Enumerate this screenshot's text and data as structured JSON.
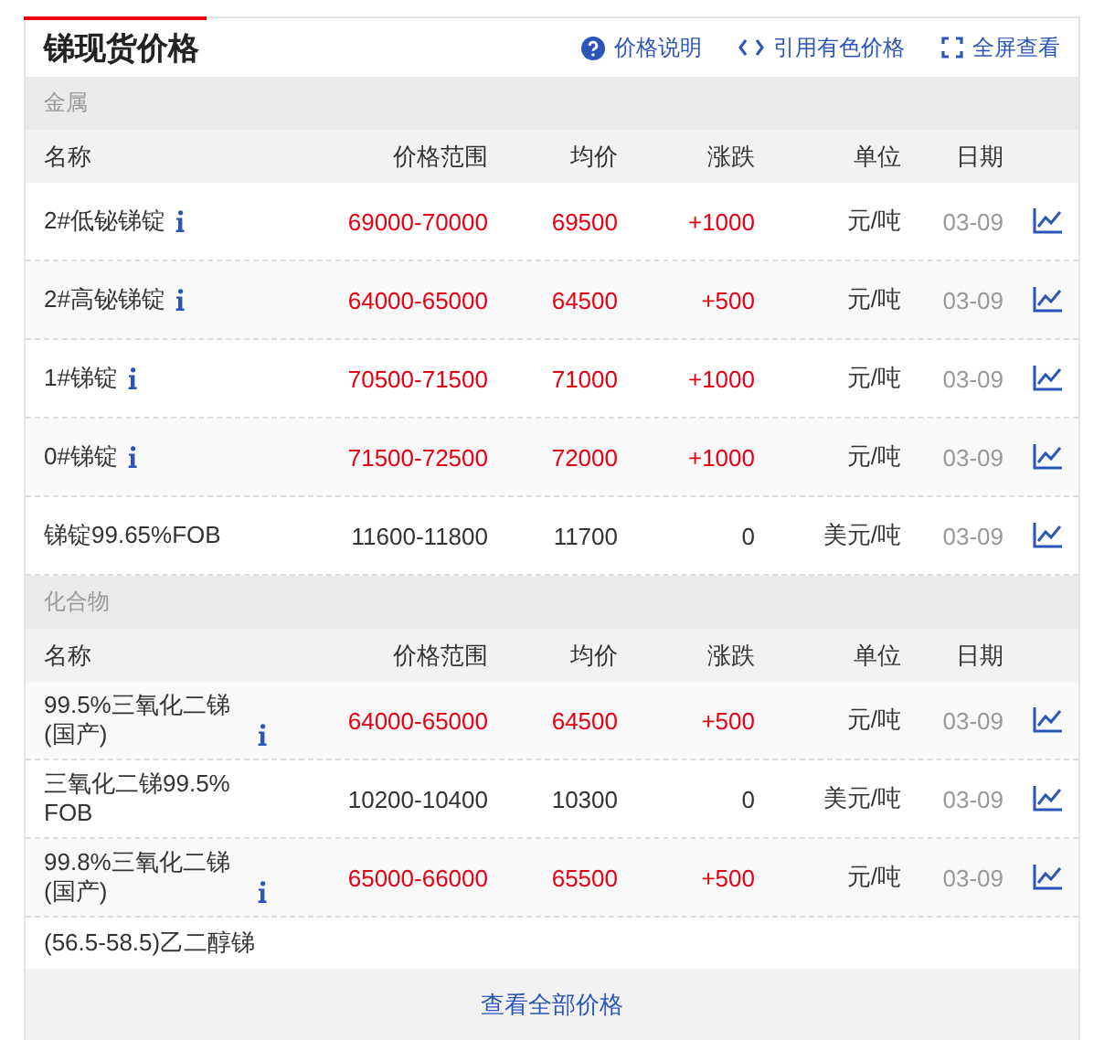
{
  "panel": {
    "title": "锑现货价格",
    "actions": [
      {
        "kind": "help",
        "label": "价格说明"
      },
      {
        "kind": "embed",
        "label": "引用有色价格"
      },
      {
        "kind": "fullscreen",
        "label": "全屏查看"
      }
    ]
  },
  "sections": [
    {
      "category": "金属",
      "columns": [
        "名称",
        "价格范围",
        "均价",
        "涨跌",
        "单位",
        "日期"
      ],
      "rows": [
        {
          "name": "2#低铋锑锭",
          "info": true,
          "range": "69000-70000",
          "average": "69500",
          "change": "+1000",
          "rising": true,
          "unit": "元/吨",
          "date": "03-09"
        },
        {
          "name": "2#高铋锑锭",
          "info": true,
          "range": "64000-65000",
          "average": "64500",
          "change": "+500",
          "rising": true,
          "unit": "元/吨",
          "date": "03-09"
        },
        {
          "name": "1#锑锭",
          "info": true,
          "range": "70500-71500",
          "average": "71000",
          "change": "+1000",
          "rising": true,
          "unit": "元/吨",
          "date": "03-09"
        },
        {
          "name": "0#锑锭",
          "info": true,
          "range": "71500-72500",
          "average": "72000",
          "change": "+1000",
          "rising": true,
          "unit": "元/吨",
          "date": "03-09"
        },
        {
          "name": "锑锭99.65%FOB",
          "info": false,
          "range": "11600-11800",
          "average": "11700",
          "change": "0",
          "rising": false,
          "unit": "美元/吨",
          "date": "03-09"
        }
      ]
    },
    {
      "category": "化合物",
      "columns": [
        "名称",
        "价格范围",
        "均价",
        "涨跌",
        "单位",
        "日期"
      ],
      "rows": [
        {
          "name": "99.5%三氧化二锑(国产)",
          "info": true,
          "range": "64000-65000",
          "average": "64500",
          "change": "+500",
          "rising": true,
          "unit": "元/吨",
          "date": "03-09"
        },
        {
          "name": "三氧化二锑99.5% FOB",
          "info": false,
          "range": "10200-10400",
          "average": "10300",
          "change": "0",
          "rising": false,
          "unit": "美元/吨",
          "date": "03-09"
        },
        {
          "name": "99.8%三氧化二锑(国产)",
          "info": true,
          "range": "65000-66000",
          "average": "65500",
          "change": "+500",
          "rising": true,
          "unit": "元/吨",
          "date": "03-09"
        },
        {
          "name": "(56.5-58.5)乙二醇锑",
          "kind": "partial"
        }
      ]
    }
  ],
  "footer": {
    "link": "查看全部价格"
  }
}
